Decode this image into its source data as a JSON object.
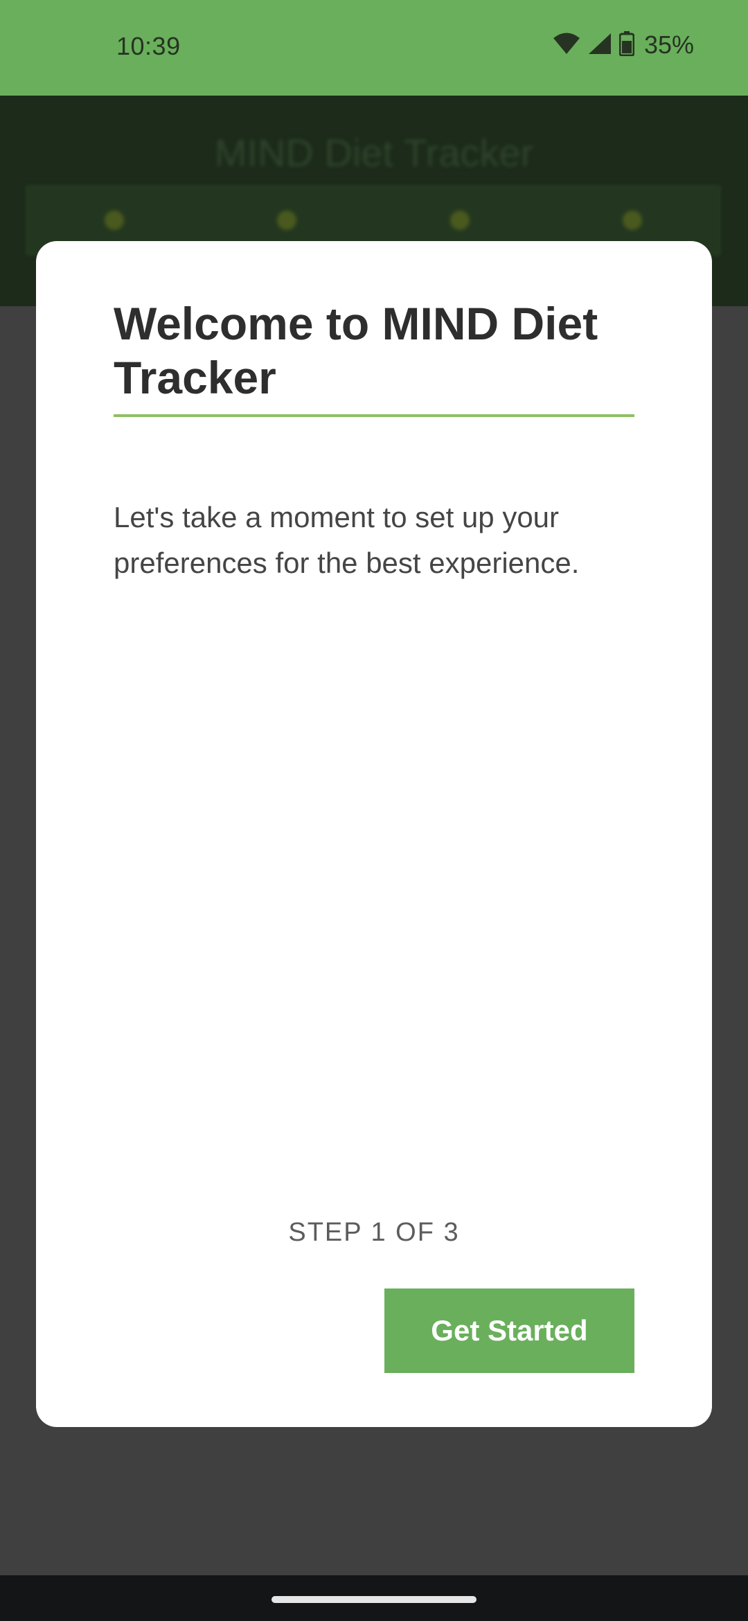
{
  "status_bar": {
    "time": "10:39",
    "battery_percent": "35%",
    "icons": [
      "wifi-icon",
      "cellular-signal-icon",
      "battery-icon"
    ]
  },
  "app_header": {
    "title": "MIND Diet Tracker"
  },
  "dialog": {
    "title": "Welcome to MIND Diet Tracker",
    "body": "Let's take a moment to set up your preferences for the best experience.",
    "step": "STEP 1 OF 3",
    "primary_button_label": "Get Started"
  },
  "colors": {
    "accent_green": "#6aaf5c",
    "rule_green": "#8cc063",
    "scrim": "#404040",
    "dialog_background": "#ffffff"
  }
}
